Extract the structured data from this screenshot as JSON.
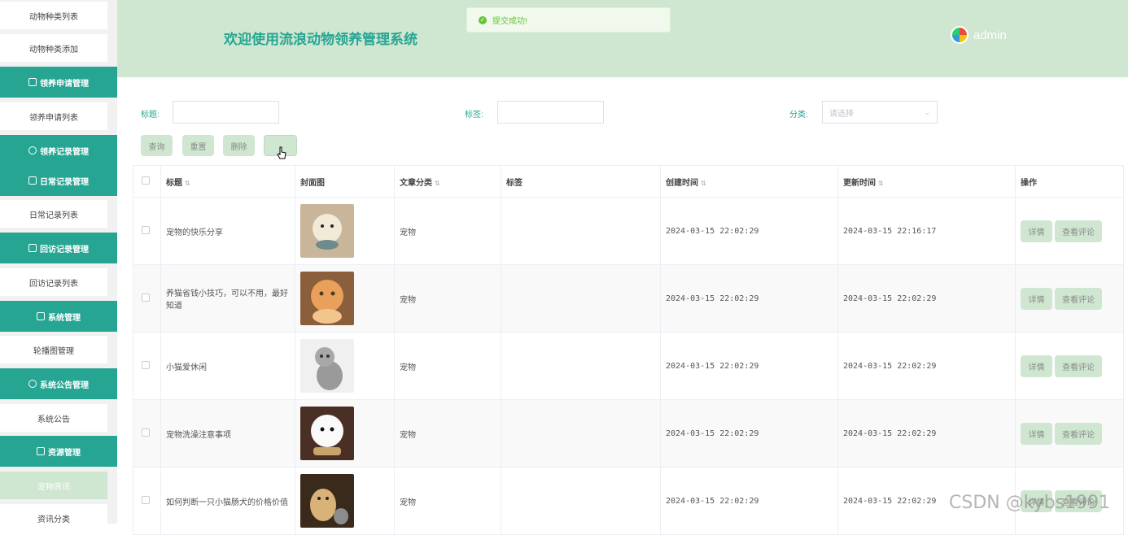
{
  "sidebar": {
    "items": [
      {
        "label": "动物种类列表",
        "type": "item"
      },
      {
        "label": "动物种类添加",
        "type": "item"
      },
      {
        "label": "领养申请管理",
        "type": "group"
      },
      {
        "label": "领养申请列表",
        "type": "item"
      },
      {
        "label": "领养记录管理",
        "type": "group"
      },
      {
        "label": "日常记录管理",
        "type": "group"
      },
      {
        "label": "日常记录列表",
        "type": "item"
      },
      {
        "label": "回访记录管理",
        "type": "group"
      },
      {
        "label": "回访记录列表",
        "type": "item"
      },
      {
        "label": "系统管理",
        "type": "group"
      },
      {
        "label": "轮播图管理",
        "type": "item"
      },
      {
        "label": "系统公告管理",
        "type": "group"
      },
      {
        "label": "系统公告",
        "type": "item"
      },
      {
        "label": "资源管理",
        "type": "group"
      },
      {
        "label": "宠物资讯",
        "type": "item-active"
      },
      {
        "label": "资讯分类",
        "type": "item"
      }
    ]
  },
  "header": {
    "title": "欢迎使用流浪动物领养管理系统",
    "toast": "提交成功!",
    "username": "admin"
  },
  "filters": {
    "title_label": "标题:",
    "tag_label": "标签:",
    "category_label": "分类:",
    "category_placeholder": "请选择"
  },
  "actions": {
    "query": "查询",
    "reset": "重置",
    "delete": "删除",
    "extra": ""
  },
  "table": {
    "headers": {
      "title": "标题",
      "cover": "封面图",
      "category": "文章分类",
      "tag": "标签",
      "created": "创建时间",
      "updated": "更新时间",
      "ops": "操作"
    },
    "op_detail": "详情",
    "op_comments": "查看评论",
    "rows": [
      {
        "title": "宠物的快乐分享",
        "category": "宠物",
        "tag": "",
        "created": "2024-03-15 22:02:29",
        "updated": "2024-03-15 22:16:17"
      },
      {
        "title": "养猫省钱小技巧，可以不用，最好知道",
        "category": "宠物",
        "tag": "",
        "created": "2024-03-15 22:02:29",
        "updated": "2024-03-15 22:02:29"
      },
      {
        "title": "小猫爱休闲",
        "category": "宠物",
        "tag": "",
        "created": "2024-03-15 22:02:29",
        "updated": "2024-03-15 22:02:29"
      },
      {
        "title": "宠物洗澡注意事项",
        "category": "宠物",
        "tag": "",
        "created": "2024-03-15 22:02:29",
        "updated": "2024-03-15 22:02:29"
      },
      {
        "title": "如何判断一只小猫肠犬的价格价值",
        "category": "宠物",
        "tag": "",
        "created": "2024-03-15 22:02:29",
        "updated": "2024-03-15 22:02:29"
      }
    ]
  },
  "watermark": "CSDN @kybs1991",
  "colors": {
    "accent": "#26a593",
    "header_bg": "#cfe6d0",
    "button_bg": "#cfe6d0",
    "success": "#67c23a"
  }
}
